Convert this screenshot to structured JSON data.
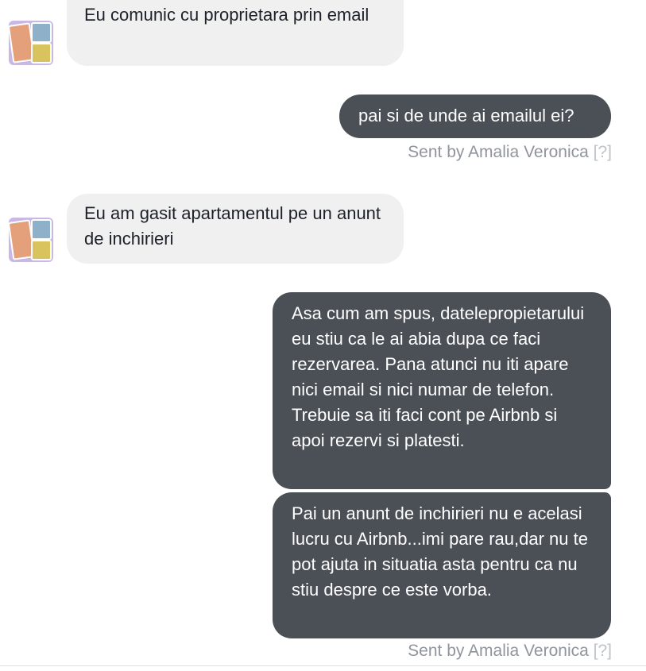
{
  "messages": [
    {
      "direction": "incoming",
      "text": "Eu comunic cu proprietara prin email"
    },
    {
      "direction": "outgoing",
      "text": "pai si de unde ai emailul ei?",
      "sent_by_prefix": "Sent by Amalia Veronica",
      "sent_by_help": "[?]"
    },
    {
      "direction": "incoming",
      "text": "Eu am gasit apartamentul pe un anunt de inchirieri"
    },
    {
      "direction": "outgoing",
      "text": "Asa cum am spus, datelepropietarului eu stiu ca le ai abia dupa ce faci rezervarea. Pana atunci nu iti apare nici email si nici numar de telefon. Trebuie sa iti faci cont pe Airbnb si apoi rezervi si platesti."
    },
    {
      "direction": "outgoing",
      "text": "Pai un anunt de inchirieri nu e acelasi lucru cu Airbnb...imi pare rau,dar nu te pot ajuta in situatia asta pentru ca nu stiu despre ce este vorba.",
      "sent_by_prefix": "Sent by Amalia Veronica",
      "sent_by_help": "[?]"
    }
  ],
  "colors": {
    "incoming_bubble": "#f0f0f0",
    "outgoing_bubble": "#4b4f56",
    "sent_by_text": "#90949c"
  },
  "icons": {
    "avatar": "contact-photo-collage"
  }
}
